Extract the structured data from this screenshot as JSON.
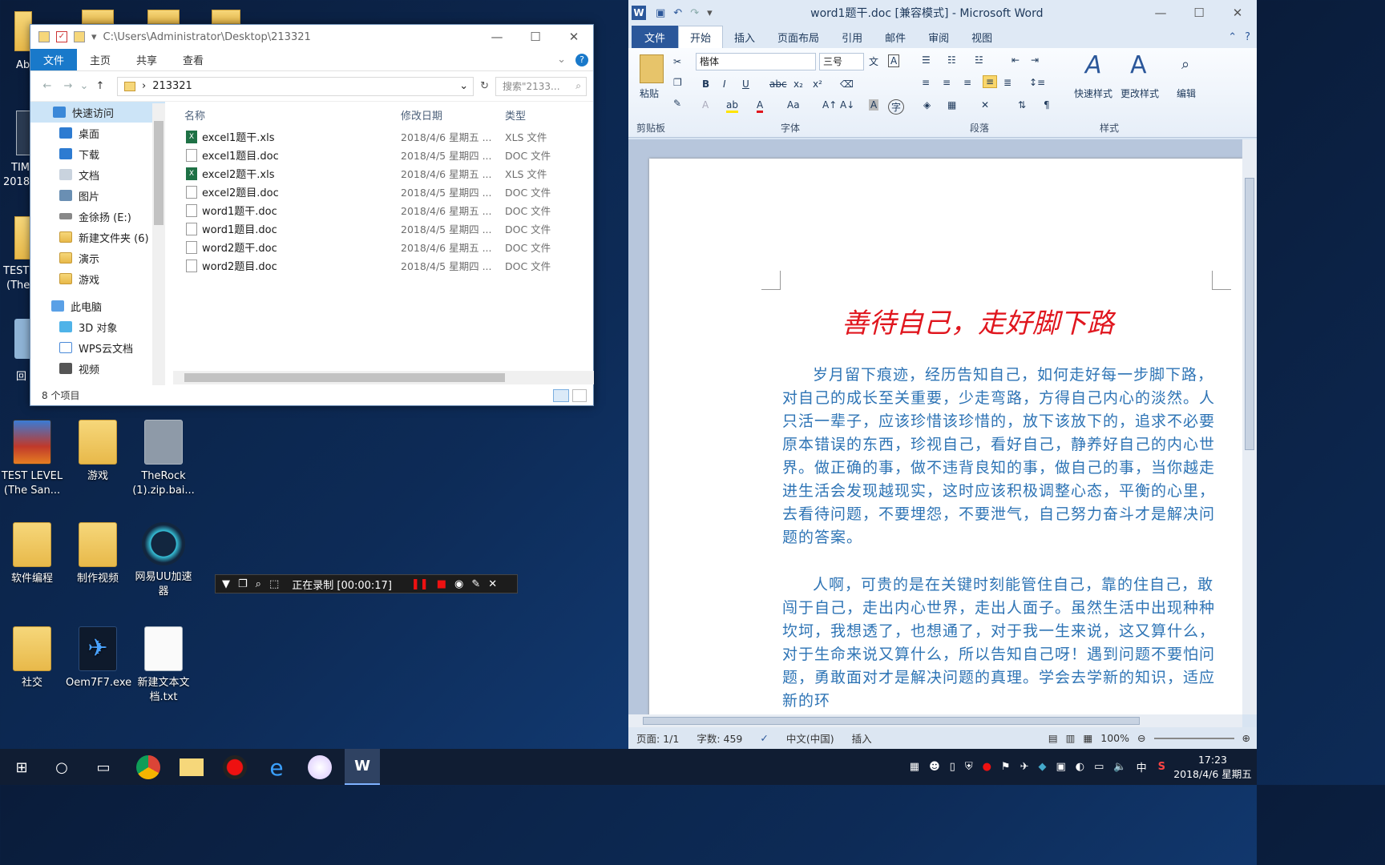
{
  "desktop": {
    "icons": [
      {
        "label": "TEST LEVEL (The San...",
        "kind": "archive"
      },
      {
        "label": "游戏",
        "kind": "folder"
      },
      {
        "label": "TheRock (1).zip.bai...",
        "kind": "file"
      },
      {
        "label": "软件编程",
        "kind": "folder"
      },
      {
        "label": "制作视频",
        "kind": "folder"
      },
      {
        "label": "网易UU加速器",
        "kind": "app"
      },
      {
        "label": "社交",
        "kind": "folder"
      },
      {
        "label": "Oem7F7.exe",
        "kind": "app"
      },
      {
        "label": "新建文本文档.txt",
        "kind": "file"
      }
    ],
    "partial_labels": [
      "Ab",
      "TIM",
      "2018",
      "TEST",
      "(The",
      "回"
    ]
  },
  "explorer": {
    "title_path": "C:\\Users\\Administrator\\Desktop\\213321",
    "ribbon_tabs": [
      "文件",
      "主页",
      "共享",
      "查看"
    ],
    "address": "213321",
    "search_placeholder": "搜索\"2133...",
    "nav": [
      {
        "label": "快速访问",
        "selected": true
      },
      {
        "label": "桌面"
      },
      {
        "label": "下载"
      },
      {
        "label": "文档"
      },
      {
        "label": "图片"
      },
      {
        "label": "金徐扬 (E:)"
      },
      {
        "label": "新建文件夹 (6)"
      },
      {
        "label": "演示"
      },
      {
        "label": "游戏"
      },
      {
        "label": "此电脑"
      },
      {
        "label": "3D 对象"
      },
      {
        "label": "WPS云文档"
      },
      {
        "label": "视频"
      }
    ],
    "columns": {
      "name": "名称",
      "date": "修改日期",
      "type": "类型"
    },
    "files": [
      {
        "name": "excel1题干.xls",
        "date": "2018/4/6 星期五 ...",
        "type": "XLS 文件",
        "kind": "xls"
      },
      {
        "name": "excel1题目.doc",
        "date": "2018/4/5 星期四 ...",
        "type": "DOC 文件",
        "kind": "doc"
      },
      {
        "name": "excel2题干.xls",
        "date": "2018/4/6 星期五 ...",
        "type": "XLS 文件",
        "kind": "xls"
      },
      {
        "name": "excel2题目.doc",
        "date": "2018/4/5 星期四 ...",
        "type": "DOC 文件",
        "kind": "doc"
      },
      {
        "name": "word1题干.doc",
        "date": "2018/4/6 星期五 ...",
        "type": "DOC 文件",
        "kind": "doc"
      },
      {
        "name": "word1题目.doc",
        "date": "2018/4/5 星期四 ...",
        "type": "DOC 文件",
        "kind": "doc"
      },
      {
        "name": "word2题干.doc",
        "date": "2018/4/6 星期五 ...",
        "type": "DOC 文件",
        "kind": "doc"
      },
      {
        "name": "word2题目.doc",
        "date": "2018/4/5 星期四 ...",
        "type": "DOC 文件",
        "kind": "doc"
      }
    ],
    "status": "8 个项目"
  },
  "recorder": {
    "status": "正在录制 [00:00:17]"
  },
  "word": {
    "title": "word1题干.doc [兼容模式] - Microsoft Word",
    "tabs": [
      "文件",
      "开始",
      "插入",
      "页面布局",
      "引用",
      "邮件",
      "审阅",
      "视图"
    ],
    "active_tab": "开始",
    "font_name": "楷体",
    "font_size": "三号",
    "groups": {
      "clipboard": "剪贴板",
      "font": "字体",
      "paragraph": "段落",
      "styles": "样式"
    },
    "buttons": {
      "paste": "粘贴",
      "quick_styles": "快速样式",
      "change_styles": "更改样式",
      "edit": "编辑"
    },
    "doc_title": "善待自己，走好脚下路",
    "paragraphs": [
      "岁月留下痕迹，经历告知自己，如何走好每一步脚下路，对自己的成长至关重要，少走弯路，方得自己内心的淡然。人只活一辈子，应该珍惜该珍惜的，放下该放下的，追求不必要原本错误的东西，珍视自己，看好自己，静养好自己的内心世界。做正确的事，做不违背良知的事，做自己的事，当你越走进生活会发现越现实，这时应该积极调整心态，平衡的心里，去看待问题，不要埋怨，不要泄气，自己努力奋斗才是解决问题的答案。",
      "人啊，可贵的是在关键时刻能管住自己，靠的住自己，敢闯于自己，走出内心世界，走出人面子。虽然生活中出现种种坎坷，我想透了，也想通了，对于我一生来说，这又算什么，对于生命来说又算什么，所以告知自己呀！遇到问题不要怕问题，勇敢面对才是解决问题的真理。学会去学新的知识，适应新的环"
    ],
    "status": {
      "page": "页面: 1/1",
      "words": "字数: 459",
      "lang": "中文(中国)",
      "mode": "插入",
      "zoom": "100%"
    },
    "colors": {
      "title": "#e0161e",
      "body": "#2e74b5",
      "accent": "#2b579a"
    }
  },
  "taskbar": {
    "time": "17:23",
    "date": "2018/4/6 星期五",
    "ime": "中"
  }
}
